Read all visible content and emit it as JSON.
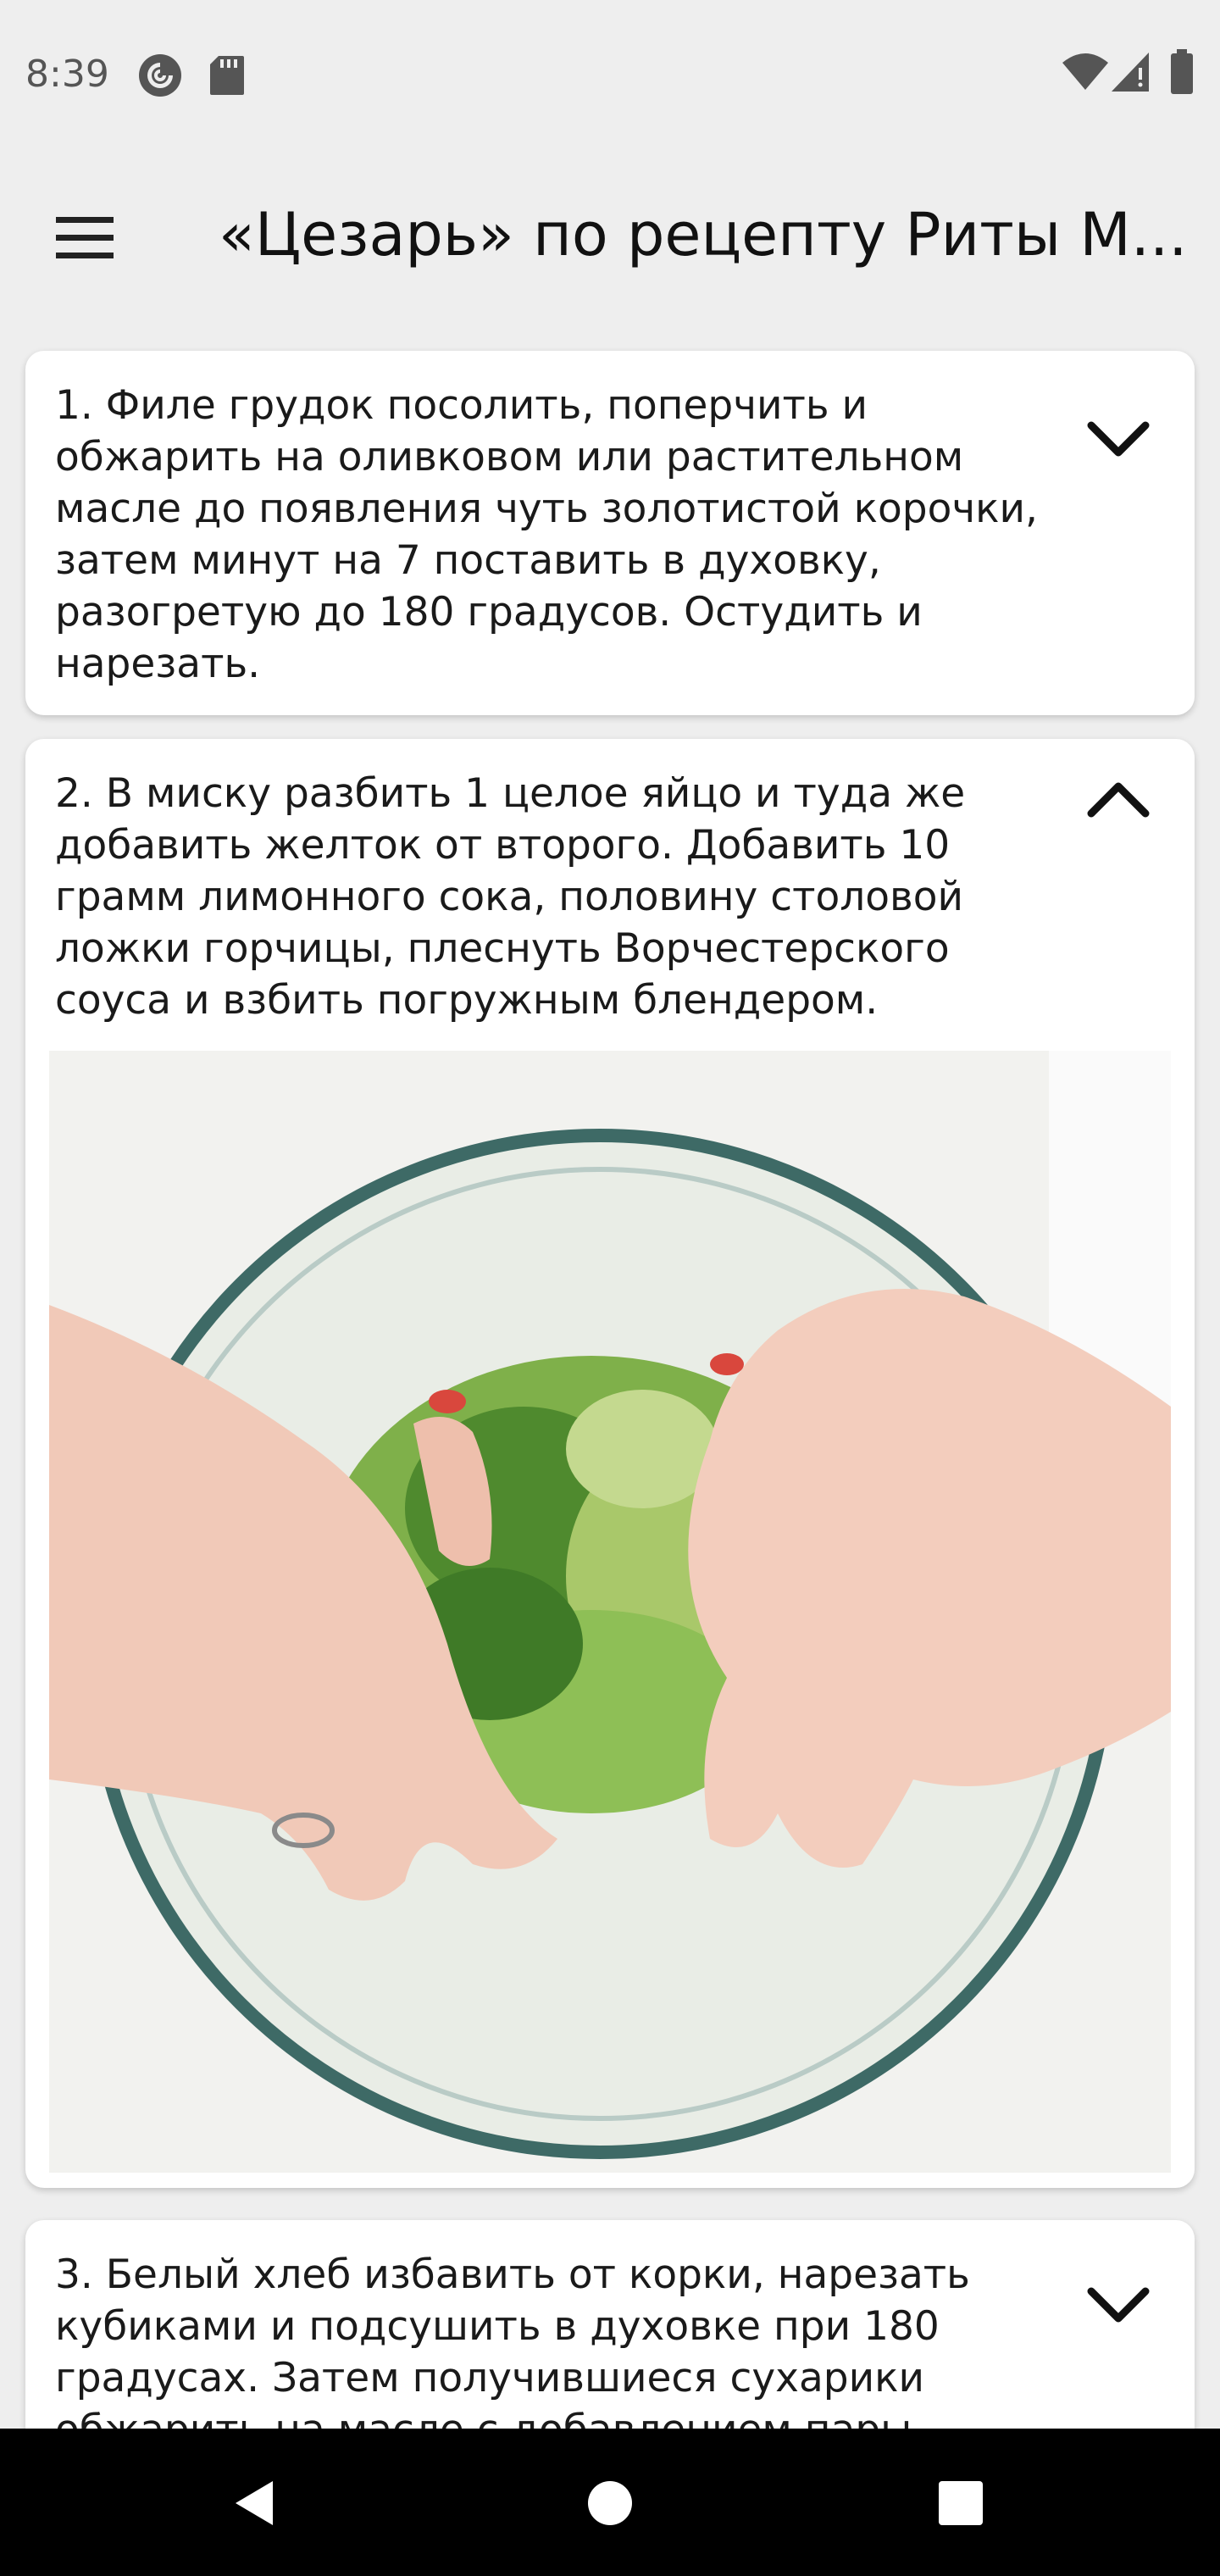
{
  "status_bar": {
    "time": "8:39",
    "left_icons": [
      "pocket-casts-icon",
      "sd-card-icon"
    ],
    "right_icons": [
      "wifi-icon",
      "cell-signal-icon",
      "battery-icon"
    ]
  },
  "app_bar": {
    "menu_icon": "hamburger-menu-icon",
    "title": "«Цезарь» по рецепту Риты М..."
  },
  "steps": [
    {
      "text": "1. Филе грудок посолить, поперчить и обжарить на оливковом или растительном масле до появления чуть золотистой корочки, затем минут на 7 поставить в духовку, разогретую до 180 градусов. Остудить и нарезать.",
      "expanded": false,
      "chevron_icon": "chevron-down-icon"
    },
    {
      "text": "2. В миску разбить 1 целое яйцо и туда же добавить желток от второго. Добавить 10 грамм лимонного сока, половину столовой ложки горчицы, плеснуть Ворчестерского соуса и взбить погружным блендером.",
      "expanded": true,
      "chevron_icon": "chevron-up-icon",
      "image": "salad-bowl-hands-photo"
    },
    {
      "text": "3. Белый хлеб избавить от корки, нарезать кубиками и подсушить в духовке при 180 градусах. Затем получившиеся сухарики обжарить на масле с добавлением пары",
      "expanded": false,
      "chevron_icon": "chevron-down-icon"
    }
  ],
  "nav_bar": {
    "buttons": [
      "back-icon",
      "home-icon",
      "recents-icon"
    ]
  }
}
